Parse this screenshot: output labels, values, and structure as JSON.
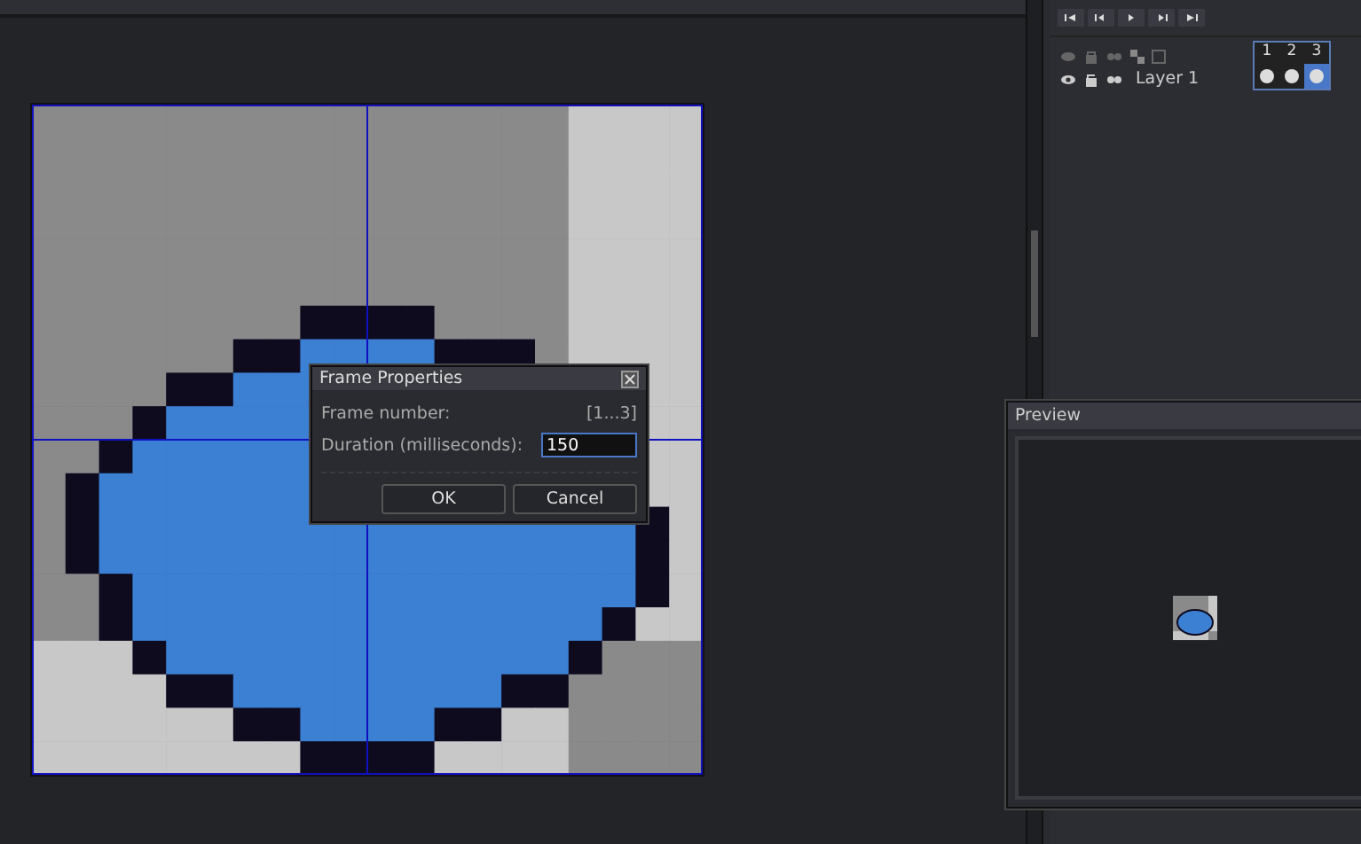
{
  "dialog": {
    "title": "Frame Properties",
    "fields": [
      {
        "kind": "readonly",
        "label": "Frame number:",
        "value": "[1...3]"
      },
      {
        "kind": "input",
        "label": "Duration (milliseconds):",
        "value": "150"
      }
    ],
    "buttons": [
      "OK",
      "Cancel"
    ]
  },
  "timeline": {
    "layers": [
      {
        "name": "Layer 1"
      }
    ],
    "frames": [
      {
        "label": "1",
        "selected": false
      },
      {
        "label": "2",
        "selected": false
      },
      {
        "label": "3",
        "selected": true
      }
    ]
  },
  "preview": {
    "title": "Preview"
  }
}
